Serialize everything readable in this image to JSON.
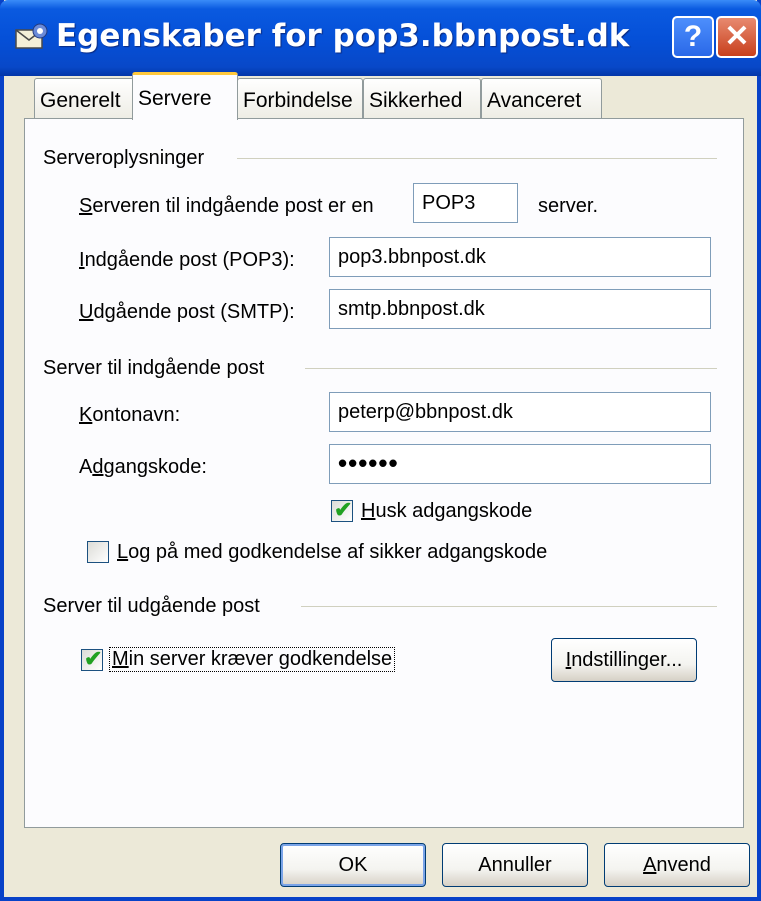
{
  "window": {
    "title": "Egenskaber for pop3.bbnpost.dk",
    "help_glyph": "?",
    "close_glyph": "✕"
  },
  "tabs": [
    {
      "label": "Generelt"
    },
    {
      "label": "Servere"
    },
    {
      "label": "Forbindelse"
    },
    {
      "label": "Sikkerhed"
    },
    {
      "label": "Avanceret"
    }
  ],
  "server_info": {
    "heading": "Serveroplysninger",
    "incoming_type_prefix": "erveren til indgående post er en",
    "incoming_type_prefix_accel": "S",
    "incoming_type_value": "POP3",
    "incoming_type_suffix": "server.",
    "incoming_label_accel": "I",
    "incoming_label": "ndgående post (POP3):",
    "incoming_value": "pop3.bbnpost.dk",
    "outgoing_label_accel": "U",
    "outgoing_label": "dgående post (SMTP):",
    "outgoing_value": "smtp.bbnpost.dk"
  },
  "incoming_server": {
    "heading": "Server til indgående post",
    "account_label_accel": "K",
    "account_label": "ontonavn:",
    "account_value": "peterp@bbnpost.dk",
    "password_label_pre": "A",
    "password_label_accel": "d",
    "password_label": "gangskode:",
    "password_value": "••••••",
    "remember_accel": "H",
    "remember_label": "usk adgangskode",
    "remember_checked": true,
    "spa_accel": "L",
    "spa_label": "og på med godkendelse af sikker adgangskode",
    "spa_checked": false
  },
  "outgoing_server": {
    "heading": "Server til udgående post",
    "auth_accel": "M",
    "auth_label": "in server kræver godkendelse",
    "auth_checked": true,
    "settings_accel": "I",
    "settings_label": "ndstillinger..."
  },
  "buttons": {
    "ok": "OK",
    "cancel": "Annuller",
    "apply_accel": "A",
    "apply": "nvend"
  },
  "colors": {
    "titlebar": "#0550d8",
    "dialog_bg": "#ece9d8",
    "active_tab_accent": "#ffc83c",
    "check_green": "#21a121"
  }
}
